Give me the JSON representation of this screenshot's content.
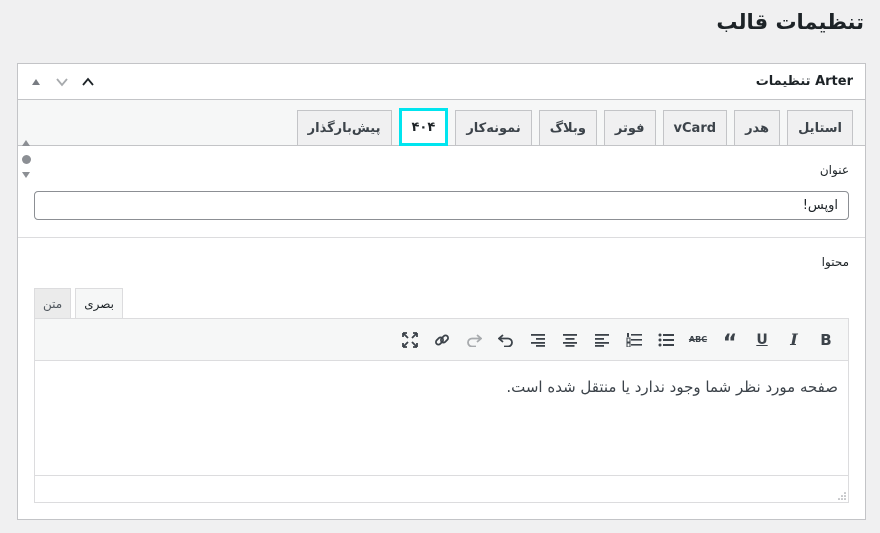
{
  "page": {
    "title": "تنظیمات قالب"
  },
  "postbox": {
    "title": "تنظیمات Arter",
    "handle_icons": [
      "chevron-up-icon",
      "chevron-down-icon",
      "triangle-up-icon"
    ]
  },
  "tabs": [
    {
      "label": "استایل",
      "active": false
    },
    {
      "label": "هدر",
      "active": false
    },
    {
      "label": "vCard",
      "active": false
    },
    {
      "label": "فوتر",
      "active": false
    },
    {
      "label": "وبلاگ",
      "active": false
    },
    {
      "label": "نمونه‌کار",
      "active": false
    },
    {
      "label": "۴۰۴",
      "active": true
    },
    {
      "label": "پیش‌بارگذار",
      "active": false
    }
  ],
  "title_field": {
    "label": "عنوان",
    "value": "اوپس!"
  },
  "content_field": {
    "label": "محتوا",
    "editor_tabs": {
      "visual": "بصری",
      "text": "متن"
    },
    "toolbar": [
      "bold-icon",
      "italic-icon",
      "underline-icon",
      "blockquote-icon",
      "strikethrough-icon",
      "bullet-list-icon",
      "numbered-list-icon",
      "align-left-icon",
      "align-center-icon",
      "align-right-icon",
      "undo-icon",
      "redo-icon",
      "link-icon",
      "fullscreen-icon"
    ],
    "body": "صفحه مورد نظر شما وجود ندارد یا منتقل شده است."
  },
  "colors": {
    "active_tab_highlight": "#00e5ef",
    "border": "#c3c4c7",
    "background": "#f0f0f1"
  }
}
